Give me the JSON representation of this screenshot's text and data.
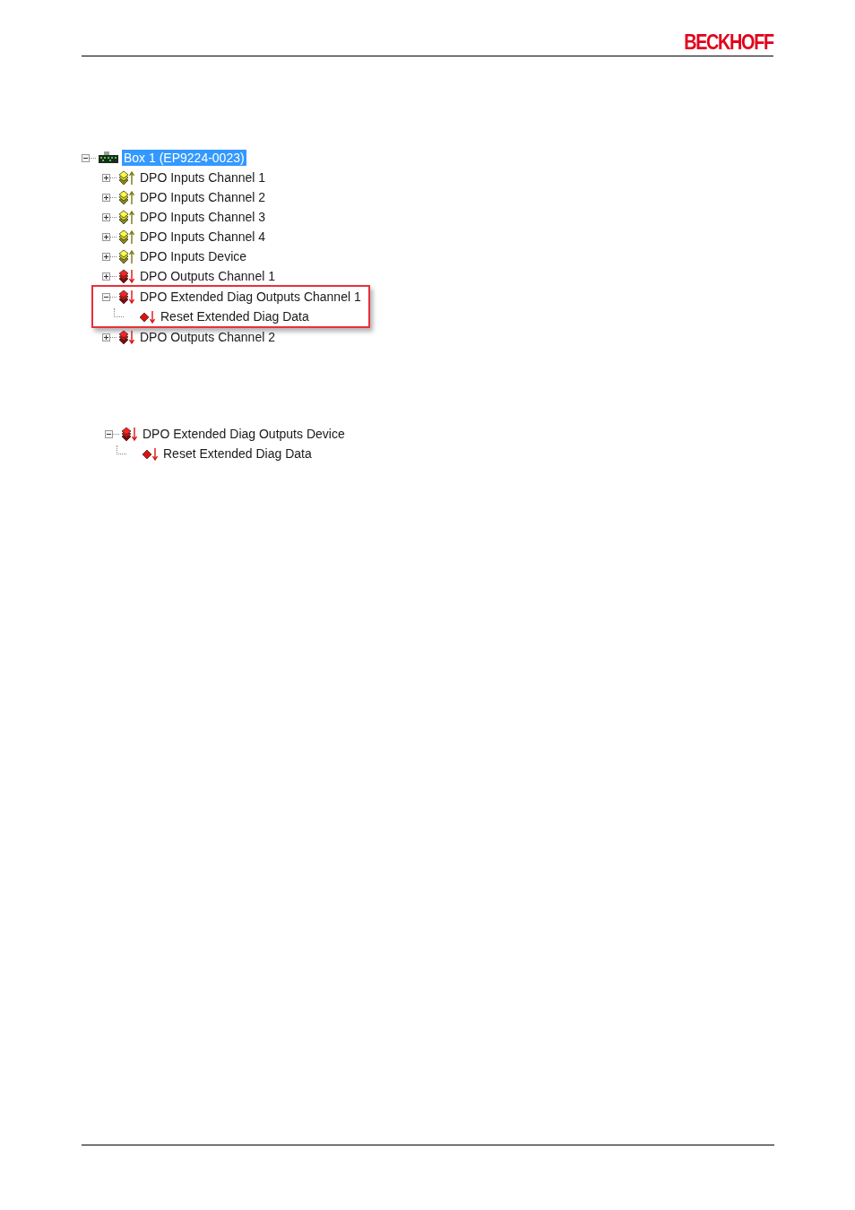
{
  "header": {
    "logo": "BECKHOFF"
  },
  "trees": [
    {
      "nodes": [
        {
          "label": "Box 1 (EP9224-0023)",
          "kind": "device",
          "selected": true,
          "expanded": true,
          "children": [
            {
              "label": "DPO Inputs Channel 1",
              "kind": "input",
              "selected": false,
              "expanded": false
            },
            {
              "label": "DPO Inputs Channel 2",
              "kind": "input",
              "selected": false,
              "expanded": false
            },
            {
              "label": "DPO Inputs Channel 3",
              "kind": "input",
              "selected": false,
              "expanded": false
            },
            {
              "label": "DPO Inputs Channel 4",
              "kind": "input",
              "selected": false,
              "expanded": false
            },
            {
              "label": "DPO Inputs Device",
              "kind": "input",
              "selected": false,
              "expanded": false
            },
            {
              "label": "DPO Outputs Channel 1",
              "kind": "output",
              "selected": false,
              "expanded": false
            },
            {
              "label": "DPO Extended Diag Outputs Channel 1",
              "kind": "output",
              "selected": false,
              "expanded": true,
              "highlighted": true,
              "children": [
                {
                  "label": "Reset Extended Diag Data",
                  "kind": "variable",
                  "selected": false
                }
              ]
            },
            {
              "label": "DPO Outputs Channel 2",
              "kind": "output",
              "selected": false,
              "expanded": false
            }
          ]
        }
      ]
    },
    {
      "nodes": [
        {
          "label": "DPO Extended Diag Outputs Device",
          "kind": "output",
          "selected": false,
          "expanded": true,
          "children": [
            {
              "label": "Reset Extended Diag Data",
              "kind": "variable",
              "selected": false
            }
          ]
        }
      ]
    }
  ]
}
